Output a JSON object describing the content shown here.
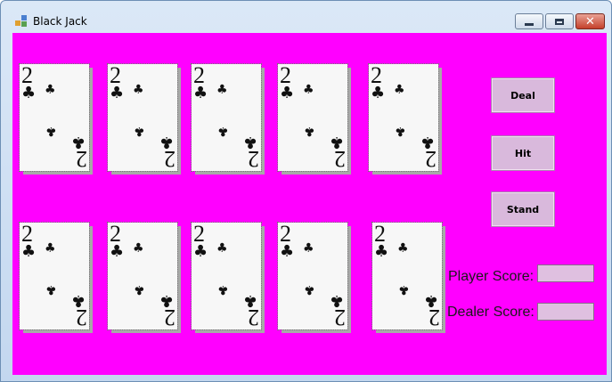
{
  "window": {
    "title": "Black Jack"
  },
  "cards": {
    "top": [
      {
        "rank": "2",
        "suit": "♣"
      },
      {
        "rank": "2",
        "suit": "♣"
      },
      {
        "rank": "2",
        "suit": "♣"
      },
      {
        "rank": "2",
        "suit": "♣"
      },
      {
        "rank": "2",
        "suit": "♣"
      }
    ],
    "bottom": [
      {
        "rank": "2",
        "suit": "♣"
      },
      {
        "rank": "2",
        "suit": "♣"
      },
      {
        "rank": "2",
        "suit": "♣"
      },
      {
        "rank": "2",
        "suit": "♣"
      },
      {
        "rank": "2",
        "suit": "♣"
      }
    ]
  },
  "buttons": {
    "deal": "Deal",
    "hit": "Hit",
    "stand": "Stand"
  },
  "scores": {
    "player_label": "Player Score:",
    "dealer_label": "Dealer Score:",
    "player_value": "",
    "dealer_value": ""
  },
  "colors": {
    "background": "#ff00ff",
    "button": "#d9b9dc"
  }
}
